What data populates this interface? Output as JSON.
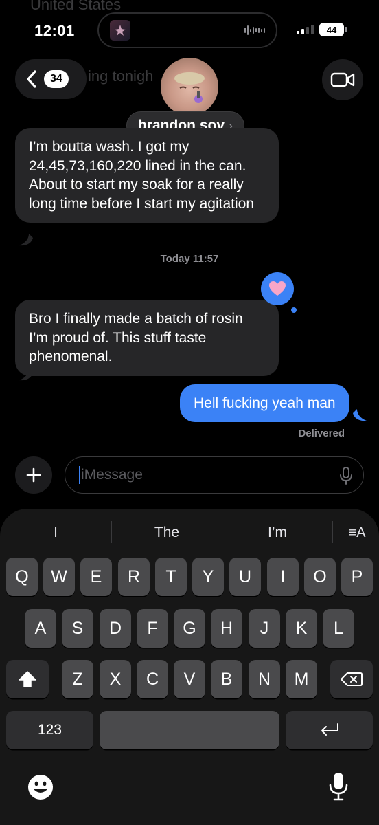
{
  "background_messages": {
    "top_fragment": "United States",
    "behind_back_fragment": "ing tonigh"
  },
  "status_bar": {
    "time": "12:01",
    "battery": "44"
  },
  "header": {
    "back_count": "34",
    "contact_name": "brandon sov"
  },
  "messages": [
    {
      "direction": "incoming",
      "text": "I’m boutta wash. I got my 24,45,73,160,220 lined in the can. About to start my soak for a really long time before I start my agitation"
    },
    {
      "direction": "timestamp",
      "text": "Today 11:57"
    },
    {
      "direction": "incoming",
      "text": "Bro I finally made a batch of rosin I’m proud of. This stuff taste phenomenal.",
      "reaction": "heart"
    },
    {
      "direction": "outgoing",
      "text": "Hell fucking yeah man",
      "status": "Delivered"
    }
  ],
  "composer": {
    "placeholder": "iMessage"
  },
  "keyboard": {
    "predictions": [
      "I",
      "The",
      "I’m"
    ],
    "row1": [
      "Q",
      "W",
      "E",
      "R",
      "T",
      "Y",
      "U",
      "I",
      "O",
      "P"
    ],
    "row2": [
      "A",
      "S",
      "D",
      "F",
      "G",
      "H",
      "J",
      "K",
      "L"
    ],
    "row3": [
      "Z",
      "X",
      "C",
      "V",
      "B",
      "N",
      "M"
    ],
    "numbers_key": "123",
    "format_icon": "≡A"
  },
  "colors": {
    "outgoing_bubble": "#3b82f6",
    "incoming_bubble": "#262628",
    "key": "#4a4a4c"
  },
  "icons": [
    "chevron-left-icon",
    "video-camera-icon",
    "plus-icon",
    "microphone-icon",
    "shift-icon",
    "backspace-icon",
    "return-icon",
    "emoji-icon",
    "dictation-icon",
    "heart-icon"
  ]
}
